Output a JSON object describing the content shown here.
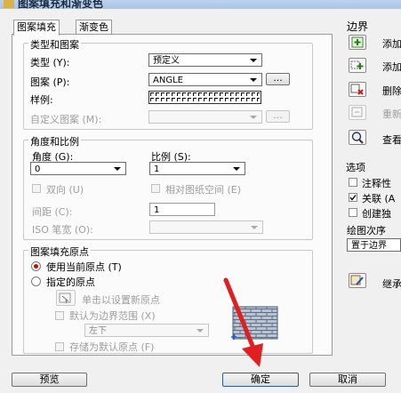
{
  "window": {
    "title": "图案填充和渐变色"
  },
  "tabs": [
    {
      "label": "图案填充"
    },
    {
      "label": "渐变色"
    }
  ],
  "type_pattern": {
    "group_title": "类型和图案",
    "type_label": "类型 (Y):",
    "type_value": "预定义",
    "pattern_label": "图案 (P):",
    "pattern_value": "ANGLE",
    "browse_label": "...",
    "swatch_label": "样例:",
    "custom_label": "自定义图案 (M):",
    "custom_browse_label": "..."
  },
  "angle_scale": {
    "group_title": "角度和比例",
    "angle_label": "角度 (G):",
    "angle_value": "0",
    "scale_label": "比例 (S):",
    "scale_value": "1",
    "double_label": "双向 (U)",
    "relative_label": "相对图纸空间 (E)",
    "spacing_label": "间距 (C):",
    "spacing_value": "1",
    "iso_label": "ISO 笔宽 (O):"
  },
  "origin": {
    "group_title": "图案填充原点",
    "use_current_label": "使用当前原点 (T)",
    "specified_label": "指定的原点",
    "click_set_label": "单击以设置新原点",
    "default_extents_label": "默认为边界范围 (X)",
    "position_value": "左下",
    "store_default_label": "存储为默认原点 (F)"
  },
  "boundaries": {
    "title": "边界",
    "add_pick_label": "添加",
    "add_select_label": "添加",
    "remove_label": "删除",
    "recreate_label": "重新",
    "view_label": "查看"
  },
  "options": {
    "title": "选项",
    "annotative_label": "注释性",
    "associative_label": "关联 (A",
    "separate_label": "创建独",
    "draw_order_label": "绘图次序",
    "draw_order_value": "置于边界"
  },
  "inherit": {
    "label": "继承"
  },
  "footer": {
    "preview_label": "预览",
    "ok_label": "确定",
    "cancel_label": "取消"
  },
  "colors": {
    "annotation_arrow": "#e02020",
    "radio_dot": "#d00000"
  }
}
